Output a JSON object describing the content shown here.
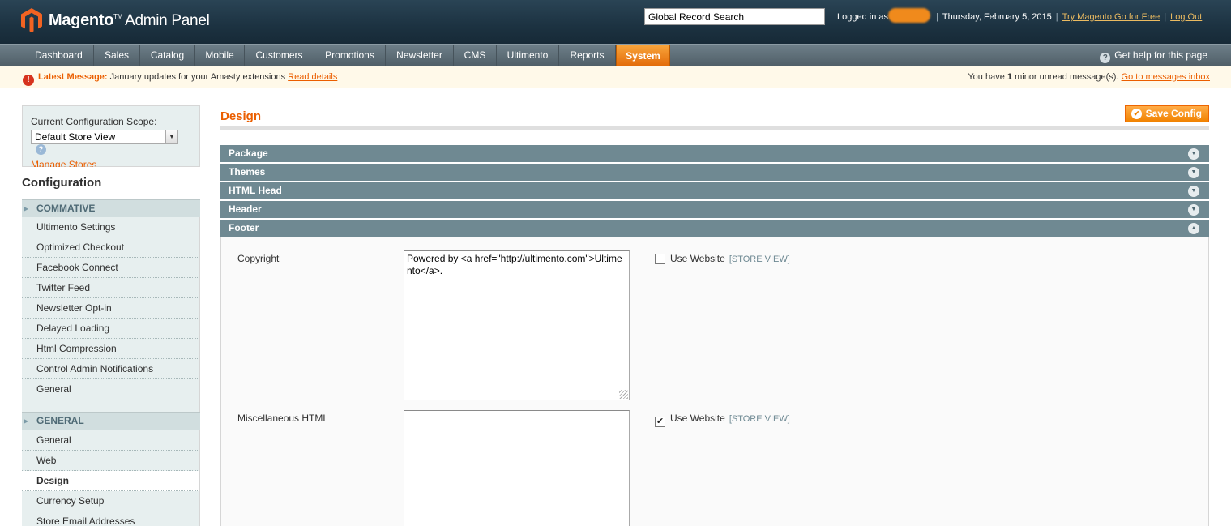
{
  "header": {
    "logo_brand": "Magento",
    "logo_tm": "TM",
    "logo_sub": "Admin Panel",
    "search_value": "Global Record Search",
    "logged_in_label": "Logged in as",
    "date": "Thursday, February 5, 2015",
    "try_link": "Try Magento Go for Free",
    "logout_link": "Log Out",
    "separator": "|"
  },
  "nav": {
    "items": [
      "Dashboard",
      "Sales",
      "Catalog",
      "Mobile",
      "Customers",
      "Promotions",
      "Newsletter",
      "CMS",
      "Ultimento",
      "Reports",
      "System"
    ],
    "active": "System",
    "help": "Get help for this page",
    "help_icon": "?"
  },
  "messages": {
    "icon": "!",
    "title": "Latest Message:",
    "text": "January updates for your Amasty extensions",
    "link": "Read details",
    "right_prefix": "You have",
    "count": "1",
    "right_suffix": "minor unread message(s).",
    "right_link": "Go to messages inbox"
  },
  "sidebar": {
    "scope_label": "Current Configuration Scope:",
    "scope_value": "Default Store View",
    "scope_arrow": "▼",
    "scope_help": "?",
    "manage_stores": "Manage Stores",
    "config_title": "Configuration",
    "sections": [
      {
        "title": "COMMATIVE",
        "items": [
          "Ultimento Settings",
          "Optimized Checkout",
          "Facebook Connect",
          "Twitter Feed",
          "Newsletter Opt-in",
          "Delayed Loading",
          "Html Compression",
          "Control Admin Notifications",
          "General"
        ]
      },
      {
        "title": "GENERAL",
        "items": [
          "General",
          "Web",
          "Design",
          "Currency Setup",
          "Store Email Addresses"
        ]
      }
    ],
    "active_item": "Design"
  },
  "main": {
    "title": "Design",
    "save_button": "Save Config",
    "save_icon": "✔",
    "fieldsets": [
      {
        "label": "Package",
        "toggle": "▼"
      },
      {
        "label": "Themes",
        "toggle": "▼"
      },
      {
        "label": "HTML Head",
        "toggle": "▼"
      },
      {
        "label": "Header",
        "toggle": "▼"
      },
      {
        "label": "Footer",
        "toggle": "▲"
      }
    ],
    "footer": {
      "copyright_label": "Copyright",
      "copyright_value": "Powered by <a href=\"http://ultimento.com\">Ultimento</a>.",
      "copyright_use_website": false,
      "misc_label": "Miscellaneous HTML",
      "misc_value": "",
      "misc_use_website": true,
      "use_website_label": "Use Website",
      "scope_tag": "[STORE VIEW]",
      "check_mark": "✔"
    }
  },
  "colors": {
    "header_bg": "#1c3241",
    "accent": "#eb5e00",
    "fieldset_head": "#6f8992"
  }
}
